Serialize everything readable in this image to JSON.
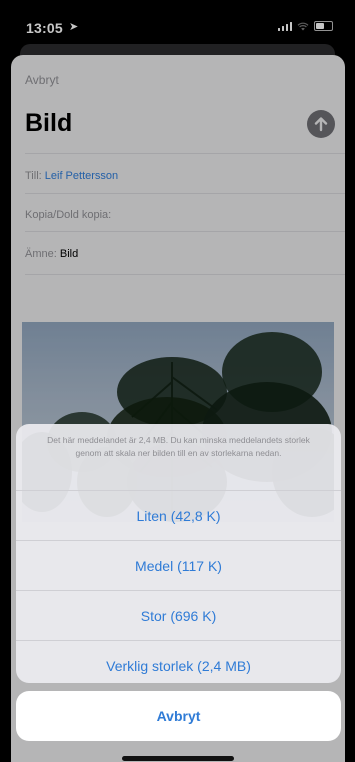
{
  "status_bar": {
    "time": "13:05"
  },
  "compose": {
    "cancel_label": "Avbryt",
    "title": "Bild",
    "to_label": "Till:",
    "to_value": "Leif Pettersson",
    "cc_label": "Kopia/Dold kopia:",
    "subject_label": "Ämne:",
    "subject_value": "Bild"
  },
  "action_sheet": {
    "message": "Det här meddelandet är 2,4 MB. Du kan minska meddelandets storlek genom att skala ner bilden till en av storlekarna nedan.",
    "options": [
      {
        "label": "Liten (42,8 K)"
      },
      {
        "label": "Medel (117 K)"
      },
      {
        "label": "Stor (696 K)"
      },
      {
        "label": "Verklig storlek (2,4 MB)"
      }
    ],
    "cancel_label": "Avbryt"
  },
  "colors": {
    "link": "#2f7bd6",
    "secondary_text": "#8e8e93"
  }
}
